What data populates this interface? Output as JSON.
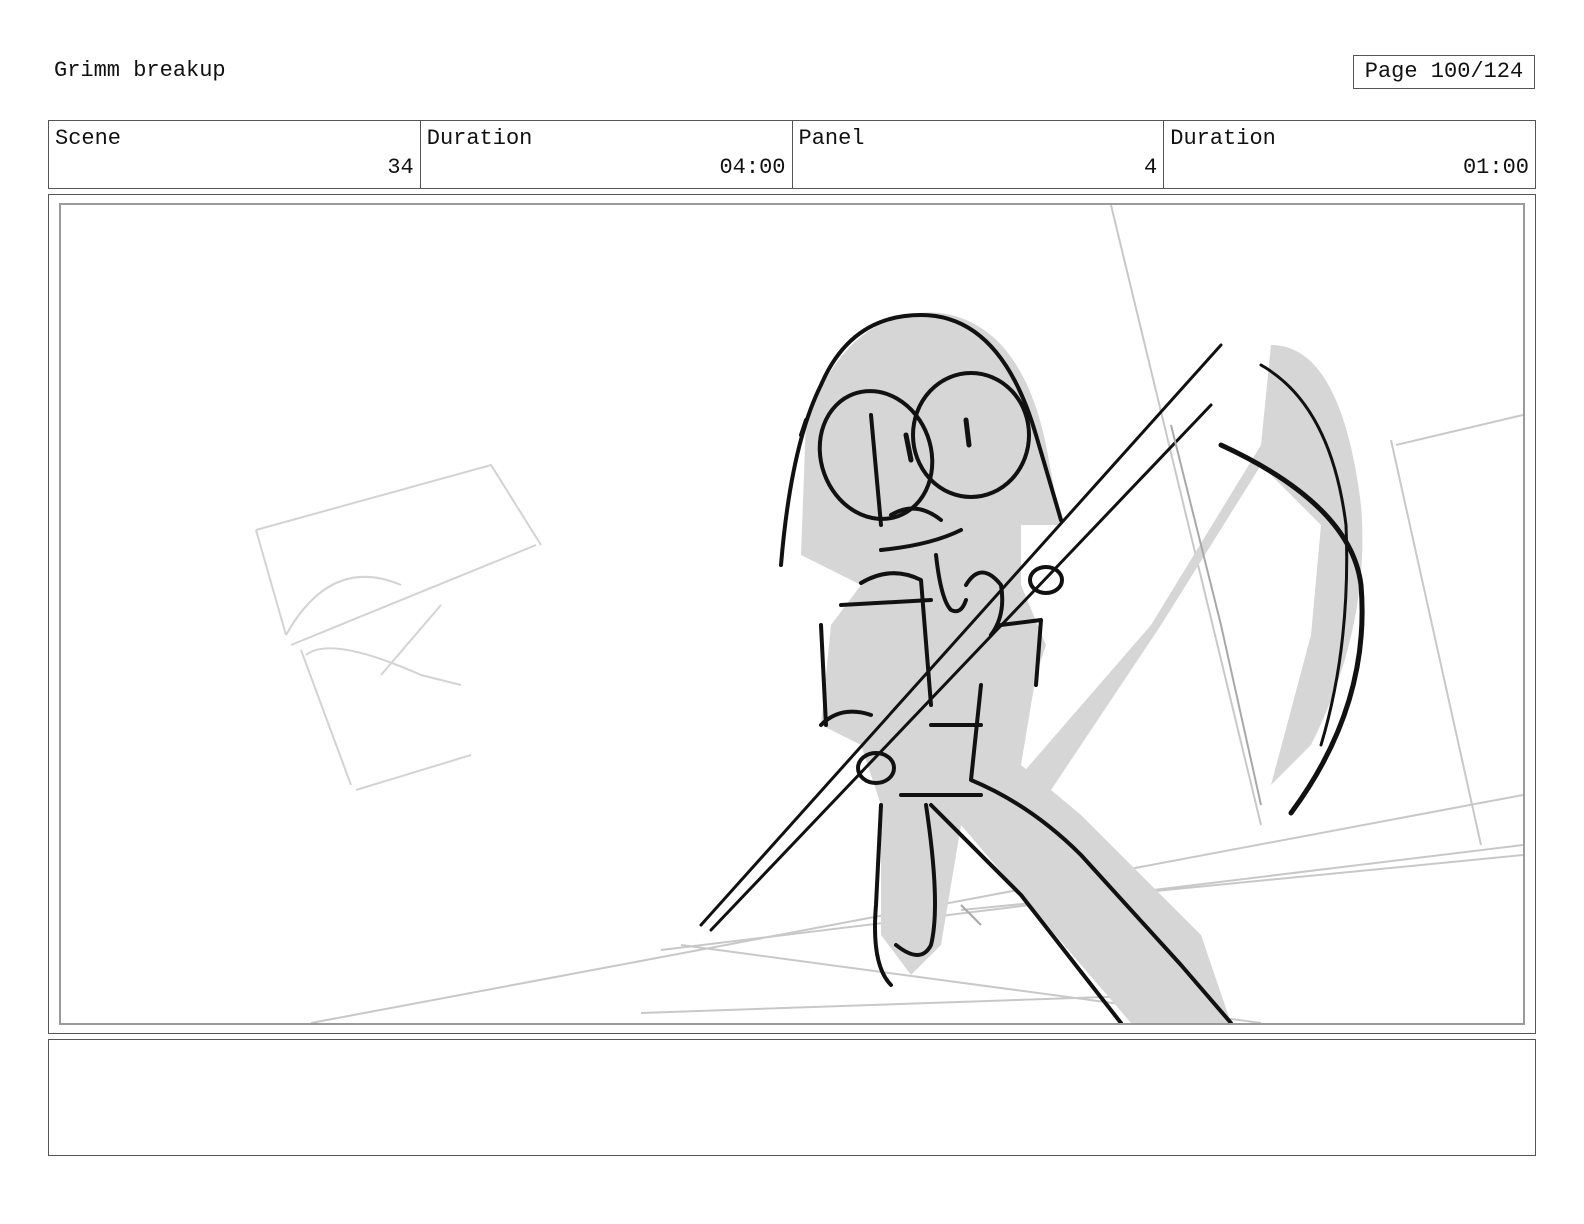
{
  "document": {
    "title": "Grimm breakup",
    "page_label": "Page 100/124"
  },
  "info": [
    {
      "label": "Scene",
      "value": "34"
    },
    {
      "label": "Duration",
      "value": "04:00"
    },
    {
      "label": "Panel",
      "value": "4"
    },
    {
      "label": "Duration",
      "value": "01:00"
    }
  ],
  "panel": {
    "image": "storyboard-sketch-character-with-scythe"
  },
  "notes": {
    "text": ""
  }
}
